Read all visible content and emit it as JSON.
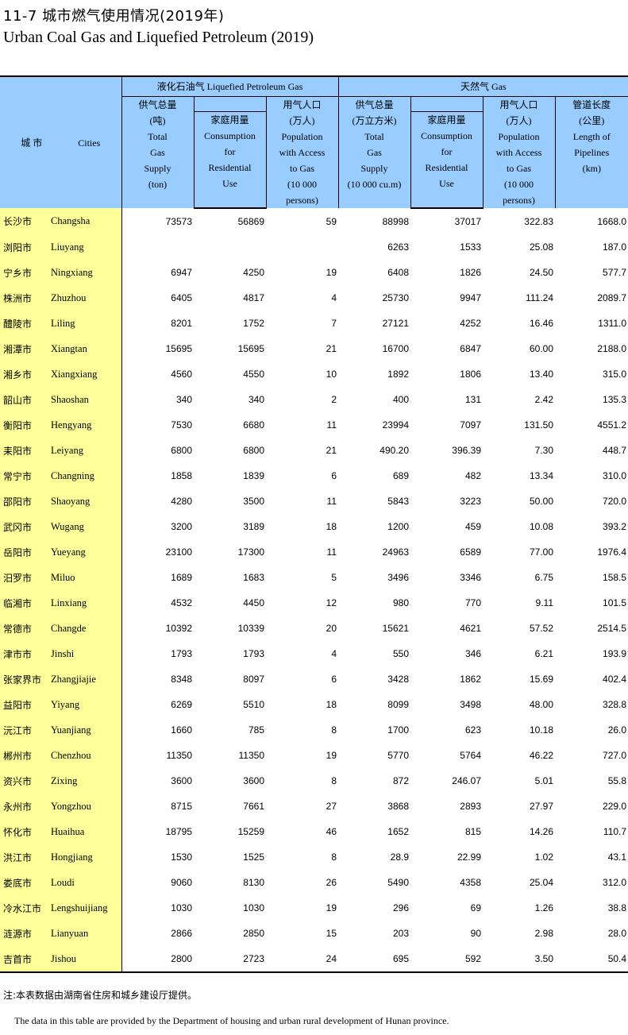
{
  "title": {
    "cn": "11-7   城市燃气使用情况(2019年)",
    "en": "Urban Coal Gas and Liquefied Petroleum (2019)"
  },
  "header": {
    "city_cn": "城 市",
    "city_en": "Cities",
    "lpg": "液化石油气   Liquefied Petroleum Gas",
    "gas": "天然气      Gas",
    "lpg_total": [
      "供气总量",
      "(吨)",
      "Total",
      "Gas",
      "Supply",
      "(ton)"
    ],
    "lpg_res": [
      "家庭用量",
      "Consumption",
      "for",
      "Residential",
      "Use"
    ],
    "lpg_pop": [
      "用气人口",
      "(万人)",
      "Population",
      "with Access",
      "to Gas",
      "(10 000",
      "persons)"
    ],
    "gas_total": [
      "供气总量",
      "(万立方米)",
      "Total",
      "Gas",
      "Supply",
      "(10 000 cu.m)"
    ],
    "gas_res": [
      "家庭用量",
      "Consumption",
      "for",
      "Residential",
      "Use"
    ],
    "gas_pop": [
      "用气人口",
      "(万人)",
      "Population",
      "with Access",
      "to Gas",
      "(10 000",
      "persons)"
    ],
    "pipe": [
      "管道长度",
      "(公里)",
      "Length of",
      "Pipelines",
      "(km)"
    ]
  },
  "rows": [
    [
      "长沙市",
      "Changsha",
      "73573",
      "56869",
      "59",
      "88998",
      "37017",
      "322.83",
      "1668.0"
    ],
    [
      "浏阳市",
      "Liuyang",
      "",
      "",
      "",
      "6263",
      "1533",
      "25.08",
      "187.0"
    ],
    [
      "宁乡市",
      "Ningxiang",
      "6947",
      "4250",
      "19",
      "6408",
      "1826",
      "24.50",
      "577.7"
    ],
    [
      "株洲市",
      "Zhuzhou",
      "6405",
      "4817",
      "4",
      "25730",
      "9947",
      "111.24",
      "2089.7"
    ],
    [
      "醴陵市",
      "Liling",
      "8201",
      "1752",
      "7",
      "27121",
      "4252",
      "16.46",
      "1311.0"
    ],
    [
      "湘潭市",
      "Xiangtan",
      "15695",
      "15695",
      "21",
      "16700",
      "6847",
      "60.00",
      "2188.0"
    ],
    [
      "湘乡市",
      "Xiangxiang",
      "4560",
      "4550",
      "10",
      "1892",
      "1806",
      "13.40",
      "315.0"
    ],
    [
      "韶山市",
      "Shaoshan",
      "340",
      "340",
      "2",
      "400",
      "131",
      "2.42",
      "135.3"
    ],
    [
      "衡阳市",
      "Hengyang",
      "7530",
      "6680",
      "11",
      "23994",
      "7097",
      "131.50",
      "4551.2"
    ],
    [
      "耒阳市",
      "Leiyang",
      "6800",
      "6800",
      "21",
      "490.20",
      "396.39",
      "7.30",
      "448.7"
    ],
    [
      "常宁市",
      "Changning",
      "1858",
      "1839",
      "6",
      "689",
      "482",
      "13.34",
      "310.0"
    ],
    [
      "邵阳市",
      "Shaoyang",
      "4280",
      "3500",
      "11",
      "5843",
      "3223",
      "50.00",
      "720.0"
    ],
    [
      "武冈市",
      "Wugang",
      "3200",
      "3189",
      "18",
      "1200",
      "459",
      "10.08",
      "393.2"
    ],
    [
      "岳阳市",
      "Yueyang",
      "23100",
      "17300",
      "11",
      "24963",
      "6589",
      "77.00",
      "1976.4"
    ],
    [
      "汨罗市",
      "Miluo",
      "1689",
      "1683",
      "5",
      "3496",
      "3346",
      "6.75",
      "158.5"
    ],
    [
      "临湘市",
      "Linxiang",
      "4532",
      "4450",
      "12",
      "980",
      "770",
      "9.11",
      "101.5"
    ],
    [
      "常德市",
      "Changde",
      "10392",
      "10339",
      "20",
      "15621",
      "4621",
      "57.52",
      "2514.5"
    ],
    [
      "津市市",
      "Jinshi",
      "1793",
      "1793",
      "4",
      "550",
      "346",
      "6.21",
      "193.9"
    ],
    [
      "张家界市",
      "Zhangjiajie",
      "8348",
      "8097",
      "6",
      "3428",
      "1862",
      "15.69",
      "402.4"
    ],
    [
      "益阳市",
      "Yiyang",
      "6269",
      "5510",
      "18",
      "8099",
      "3498",
      "48.00",
      "328.8"
    ],
    [
      "沅江市",
      "Yuanjiang",
      "1660",
      "785",
      "8",
      "1700",
      "623",
      "10.18",
      "26.0"
    ],
    [
      "郴州市",
      "Chenzhou",
      "11350",
      "11350",
      "19",
      "5770",
      "5764",
      "46.22",
      "727.0"
    ],
    [
      "资兴市",
      "Zixing",
      "3600",
      "3600",
      "8",
      "872",
      "246.07",
      "5.01",
      "55.8"
    ],
    [
      "永州市",
      "Yongzhou",
      "8715",
      "7661",
      "27",
      "3868",
      "2893",
      "27.97",
      "229.0"
    ],
    [
      "怀化市",
      "Huaihua",
      "18795",
      "15259",
      "46",
      "1652",
      "815",
      "14.26",
      "110.7"
    ],
    [
      "洪江市",
      "Hongjiang",
      "1530",
      "1525",
      "8",
      "28.9",
      "22.99",
      "1.02",
      "43.1"
    ],
    [
      "娄底市",
      "Loudi",
      "9060",
      "8130",
      "26",
      "5490",
      "4358",
      "25.04",
      "312.0"
    ],
    [
      "冷水江市",
      "Lengshuijiang",
      "1030",
      "1030",
      "19",
      "296",
      "69",
      "1.26",
      "38.8"
    ],
    [
      "涟源市",
      "Lianyuan",
      "2866",
      "2850",
      "15",
      "203",
      "90",
      "2.98",
      "28.0"
    ],
    [
      "吉首市",
      "Jishou",
      "2800",
      "2723",
      "24",
      "695",
      "592",
      "3.50",
      "50.4"
    ]
  ],
  "notes": {
    "cn": "注:本表数据由湖南省住房和城乡建设厅提供。",
    "en": "The data in this table are provided by the Department of housing and urban rural development of Hunan province."
  }
}
